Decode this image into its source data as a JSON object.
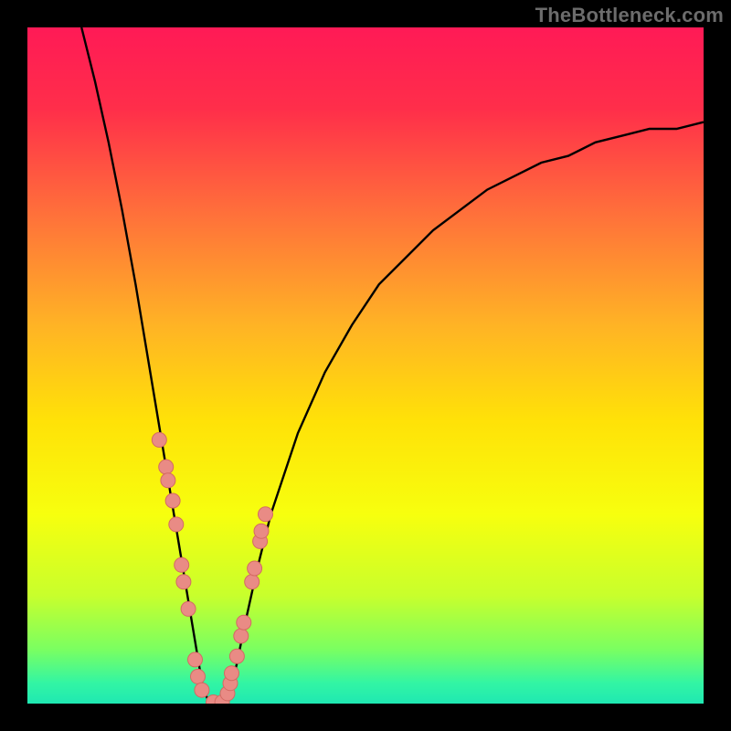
{
  "watermark": "TheBottleneck.com",
  "colors": {
    "frame": "#000000",
    "curve": "#000000",
    "marker_fill": "#e98b85",
    "marker_stroke": "#d46a63",
    "gradient_stops": [
      {
        "offset": 0.0,
        "color": "#ff1a56"
      },
      {
        "offset": 0.12,
        "color": "#ff2e4a"
      },
      {
        "offset": 0.28,
        "color": "#ff723a"
      },
      {
        "offset": 0.44,
        "color": "#ffb325"
      },
      {
        "offset": 0.58,
        "color": "#ffe108"
      },
      {
        "offset": 0.72,
        "color": "#f7ff0e"
      },
      {
        "offset": 0.84,
        "color": "#c8ff2c"
      },
      {
        "offset": 0.92,
        "color": "#7aff61"
      },
      {
        "offset": 0.97,
        "color": "#32f5a4"
      },
      {
        "offset": 1.0,
        "color": "#1fe8b2"
      }
    ]
  },
  "chart_data": {
    "type": "line",
    "title": "",
    "xlabel": "",
    "ylabel": "",
    "xlim": [
      0,
      100
    ],
    "ylim": [
      0,
      100
    ],
    "series": [
      {
        "name": "curve",
        "x": [
          8,
          10,
          12,
          14,
          16,
          18,
          20,
          21,
          22,
          23,
          24,
          25,
          26,
          27,
          28,
          29,
          30,
          31,
          32,
          34,
          36,
          38,
          40,
          44,
          48,
          52,
          56,
          60,
          64,
          68,
          72,
          76,
          80,
          84,
          88,
          92,
          96,
          100
        ],
        "y": [
          100,
          92,
          83,
          73,
          62,
          50,
          38,
          32,
          26,
          20,
          14,
          8,
          2,
          0,
          0,
          0,
          2,
          6,
          11,
          20,
          28,
          34,
          40,
          49,
          56,
          62,
          66,
          70,
          73,
          76,
          78,
          80,
          81,
          83,
          84,
          85,
          85,
          86
        ]
      }
    ],
    "markers": {
      "name": "dots",
      "x": [
        19.5,
        20.5,
        20.8,
        21.5,
        22.0,
        22.8,
        23.1,
        23.8,
        24.8,
        25.2,
        25.8,
        27.5,
        28.8,
        29.6,
        30.0,
        30.2,
        31.0,
        31.6,
        32.0,
        33.2,
        33.6,
        34.4,
        34.6,
        35.2
      ],
      "y": [
        39.0,
        35.0,
        33.0,
        30.0,
        26.5,
        20.5,
        18.0,
        14.0,
        6.5,
        4.0,
        2.0,
        0.2,
        0.2,
        1.5,
        3.0,
        4.5,
        7.0,
        10.0,
        12.0,
        18.0,
        20.0,
        24.0,
        25.5,
        28.0
      ]
    }
  }
}
